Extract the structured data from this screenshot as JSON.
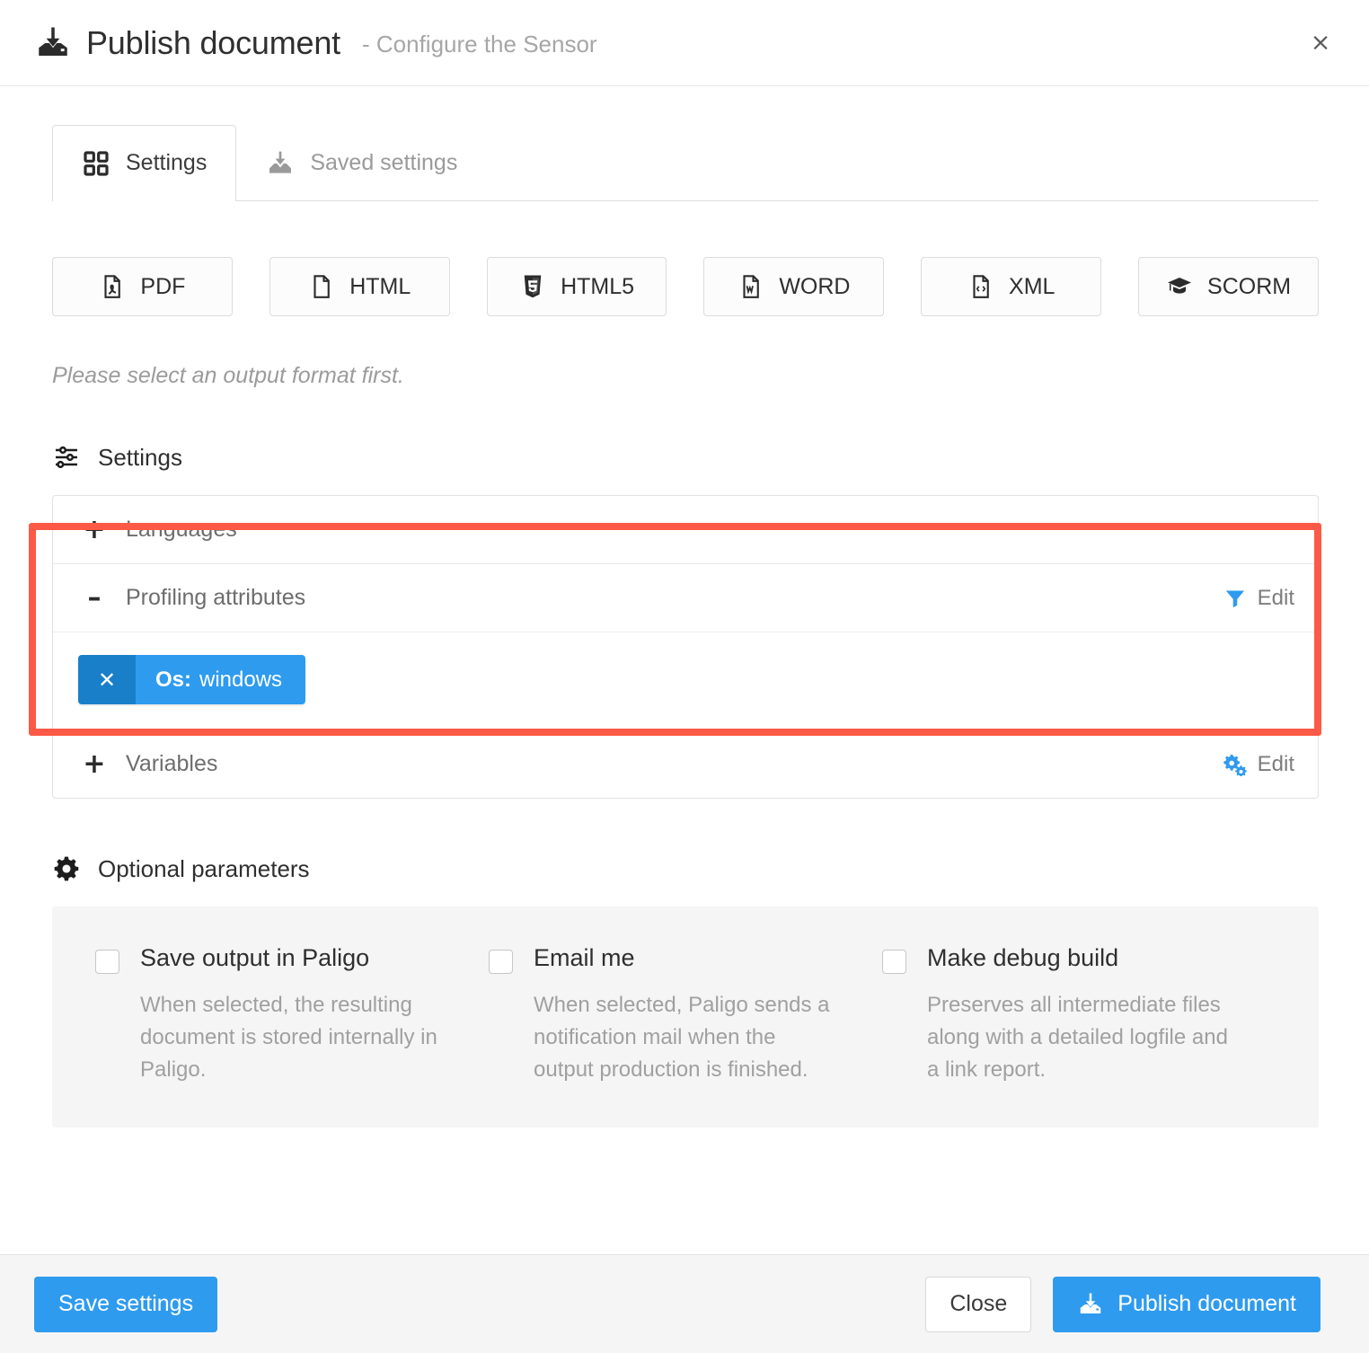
{
  "header": {
    "icon": "publish-download-icon",
    "title": "Publish document",
    "subtitle": "- Configure the Sensor",
    "close_label": "×"
  },
  "tabs": [
    {
      "label": "Settings",
      "icon": "grid-squares-icon",
      "active": true
    },
    {
      "label": "Saved settings",
      "icon": "inbox-download-icon",
      "active": false
    }
  ],
  "formats": [
    {
      "label": "PDF",
      "icon": "file-pdf-icon"
    },
    {
      "label": "HTML",
      "icon": "file-blank-icon"
    },
    {
      "label": "HTML5",
      "icon": "html5-shield-icon"
    },
    {
      "label": "WORD",
      "icon": "file-word-icon"
    },
    {
      "label": "XML",
      "icon": "file-code-icon"
    },
    {
      "label": "SCORM",
      "icon": "graduation-cap-icon"
    }
  ],
  "hint": "Please select an output format first.",
  "settings_section": {
    "heading": "Settings",
    "heading_icon": "sliders-icon",
    "items": [
      {
        "label": "Languages",
        "sign": "+",
        "expanded": false,
        "edit": null
      },
      {
        "label": "Profiling attributes",
        "sign": "–",
        "expanded": true,
        "edit": {
          "label": "Edit",
          "icon": "filter-funnel-icon"
        },
        "tag": {
          "remove_label": "✕",
          "key": "Os:",
          "value": "windows"
        }
      },
      {
        "label": "Variables",
        "sign": "+",
        "expanded": false,
        "edit": {
          "label": "Edit",
          "icon": "cogs-icon"
        }
      }
    ]
  },
  "optional_parameters": {
    "heading": "Optional parameters",
    "heading_icon": "gear-icon",
    "options": [
      {
        "label": "Save output in Paligo",
        "description": "When selected, the resulting document is stored internally in Paligo.",
        "checked": false
      },
      {
        "label": "Email me",
        "description": "When selected, Paligo sends a notification mail when the output production is finished.",
        "checked": false
      },
      {
        "label": "Make debug build",
        "description": "Preserves all intermediate files along with a detailed logfile and a link report.",
        "checked": false
      }
    ]
  },
  "footer": {
    "save_label": "Save settings",
    "close_label": "Close",
    "publish_label": "Publish document",
    "publish_icon": "publish-download-icon"
  },
  "colors": {
    "accent_blue": "#2e9bef",
    "accent_blue_dark": "#1a7fc9",
    "highlight_red": "#fc5a46",
    "panel_gray": "#f5f5f5"
  }
}
